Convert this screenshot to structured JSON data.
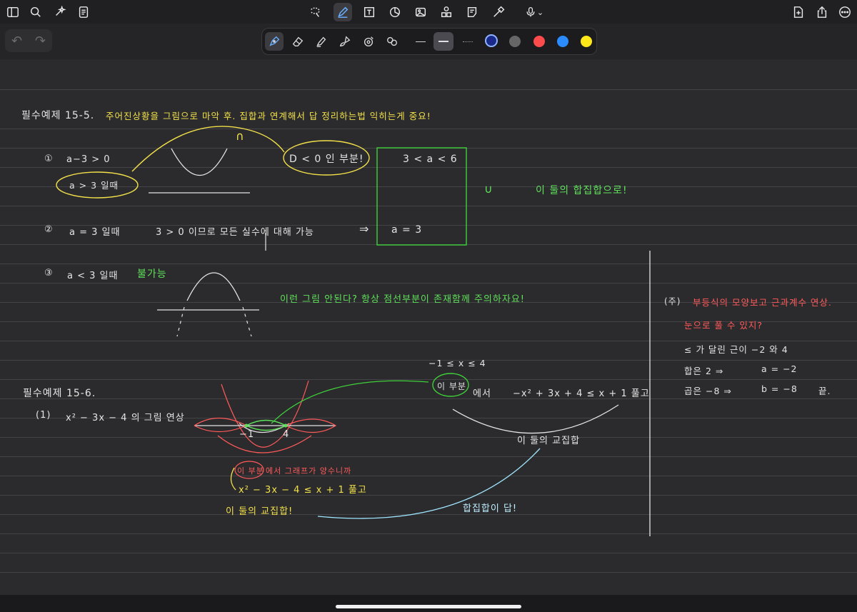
{
  "toolbar": {
    "mic_caret": "⌄"
  },
  "pen_tray": {
    "colors": {
      "dark_blue": "#1a2a8a",
      "gray": "#666666",
      "red": "#ff4b4b",
      "blue": "#2a8cff",
      "yellow": "#ffe81a"
    },
    "undo": "↶",
    "redo": "↷"
  },
  "notes": {
    "title1": "필수예제 15-5.",
    "title1_note": "주어진상황을 그림으로 마악 후. 집합과 연계해서 답 정리하는법 익히는게 중요!",
    "cap_top": "∩",
    "c1_num": "①",
    "c1_cond": "a−3 > 0",
    "c1_when": "a > 3 일때",
    "c1_d": "D < 0 인 부분!",
    "box_top": "3 < a < 6",
    "box_bottom": "a = 3",
    "union": "∪",
    "union_note": "이 둘의 합집합으로!",
    "c2_num": "②",
    "c2_when": "a = 3 일때",
    "c2_text": "3 > 0 이므로 모든 실수에 대해 가능",
    "c2_arrow": "⇒",
    "c3_num": "③",
    "c3_when": "a < 3 일때",
    "c3_no": "불가능",
    "c3_note": "이런 그림 안된다? 항상 점선부분이 존재함께 주의하자요!",
    "title2": "필수예제 15-6.",
    "p1_num": "(1)",
    "p1_text": "x² − 3x − 4 의 그림 연상",
    "range": "−1 ≤ x ≤ 4",
    "this_part": "이 부분",
    "this_part_suffix": "에서",
    "ineq_right": "−x² + 3x + 4 ≤ x + 1 풀고",
    "inter_right": "이 둘의 교집합",
    "axis_m1": "−1",
    "axis_4": "4",
    "red_note_circle": "이 부분",
    "red_note": "에서 그래프가 양수니까",
    "ineq_left": "x² − 3x − 4 ≤ x + 1 풀고",
    "inter_left": "이 둘의 교집합!",
    "union_answer": "합집합이 답!",
    "side_mark": "(주)",
    "side1": "부등식의 모양보고 근과계수 연상.",
    "side2": "눈으로 풀 수 있지?",
    "side3": "≤ 가 달린 근이 −2 와 4",
    "side4": "합은 2 ⇒",
    "side4b": "a = −2",
    "side5": "곱은 −8 ⇒",
    "side5b": "b = −8",
    "side5c": "끝."
  }
}
